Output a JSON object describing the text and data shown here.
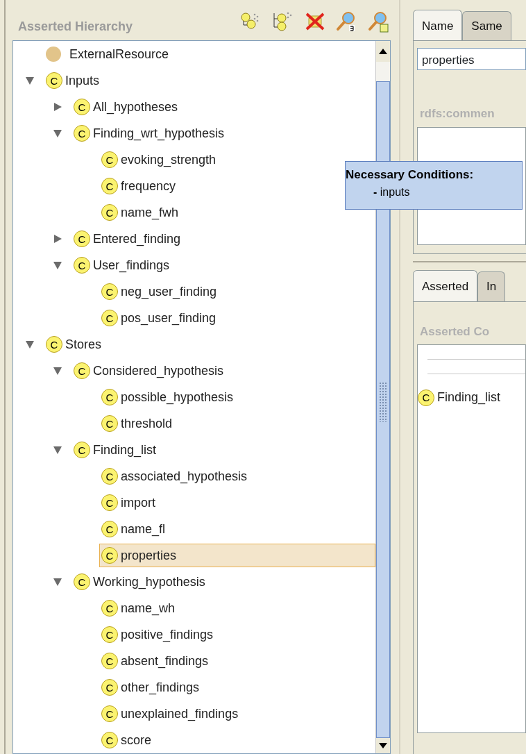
{
  "hierarchy": {
    "title": "Asserted Hierarchy",
    "tree": [
      {
        "label": "ExternalResource",
        "kind": "resource",
        "color": "#e2c48a",
        "selected": false
      },
      {
        "label": "Inputs",
        "kind": "class",
        "badge": "C",
        "expanded": true,
        "selected": false,
        "children": [
          {
            "label": "All_hypotheses",
            "kind": "class",
            "badge": "C",
            "expanded": false,
            "selected": false
          },
          {
            "label": "Finding_wrt_hypothesis",
            "kind": "class",
            "badge": "C",
            "expanded": true,
            "selected": false,
            "children": [
              {
                "label": "evoking_strength",
                "kind": "class",
                "badge": "C",
                "selected": false
              },
              {
                "label": "frequency",
                "kind": "class",
                "badge": "C",
                "selected": false
              },
              {
                "label": "name_fwh",
                "kind": "class",
                "badge": "C",
                "selected": false
              }
            ]
          },
          {
            "label": "Entered_finding",
            "kind": "class",
            "badge": "C",
            "expanded": false,
            "selected": false
          },
          {
            "label": "User_findings",
            "kind": "class",
            "badge": "C",
            "expanded": true,
            "selected": false,
            "children": [
              {
                "label": "neg_user_finding",
                "kind": "class",
                "badge": "C",
                "selected": false
              },
              {
                "label": "pos_user_finding",
                "kind": "class",
                "badge": "C",
                "selected": false
              }
            ]
          }
        ]
      },
      {
        "label": "Stores",
        "kind": "class",
        "badge": "C",
        "expanded": true,
        "selected": false,
        "children": [
          {
            "label": "Considered_hypothesis",
            "kind": "class",
            "badge": "C",
            "expanded": true,
            "selected": false,
            "children": [
              {
                "label": "possible_hypothesis",
                "kind": "class",
                "badge": "C",
                "selected": false
              },
              {
                "label": "threshold",
                "kind": "class",
                "badge": "C",
                "selected": false
              }
            ]
          },
          {
            "label": "Finding_list",
            "kind": "class",
            "badge": "C",
            "expanded": true,
            "selected": false,
            "children": [
              {
                "label": "associated_hypothesis",
                "kind": "class",
                "badge": "C",
                "selected": false
              },
              {
                "label": "import",
                "kind": "class",
                "badge": "C",
                "selected": false
              },
              {
                "label": "name_fl",
                "kind": "class",
                "badge": "C",
                "selected": false
              },
              {
                "label": "properties",
                "kind": "class",
                "badge": "C",
                "selected": true
              }
            ]
          },
          {
            "label": "Working_hypothesis",
            "kind": "class",
            "badge": "C",
            "expanded": true,
            "selected": false,
            "children": [
              {
                "label": "name_wh",
                "kind": "class",
                "badge": "C",
                "selected": false
              },
              {
                "label": "positive_findings",
                "kind": "class",
                "badge": "C",
                "selected": false
              },
              {
                "label": "absent_findings",
                "kind": "class",
                "badge": "C",
                "selected": false
              },
              {
                "label": "other_findings",
                "kind": "class",
                "badge": "C",
                "selected": false
              },
              {
                "label": "unexplained_findings",
                "kind": "class",
                "badge": "C",
                "selected": false
              },
              {
                "label": "score",
                "kind": "class",
                "badge": "C",
                "selected": false
              }
            ]
          }
        ]
      }
    ]
  },
  "tooltip": {
    "title": "Necessary Conditions:",
    "items": [
      {
        "bullet": "-",
        "text": "inputs"
      }
    ]
  },
  "details": {
    "tabs": [
      {
        "label": "Name",
        "selected": true
      },
      {
        "label": "Same",
        "selected": false
      }
    ],
    "name_field": {
      "value": "properties"
    },
    "comment_label": "rdfs:commen",
    "condition_tabs": [
      {
        "label": "Asserted",
        "selected": true
      },
      {
        "label": "In",
        "selected": false
      }
    ],
    "conditions_label": "Asserted Co",
    "conditions": [
      {
        "label": "Finding_list",
        "badge": "C"
      }
    ]
  }
}
